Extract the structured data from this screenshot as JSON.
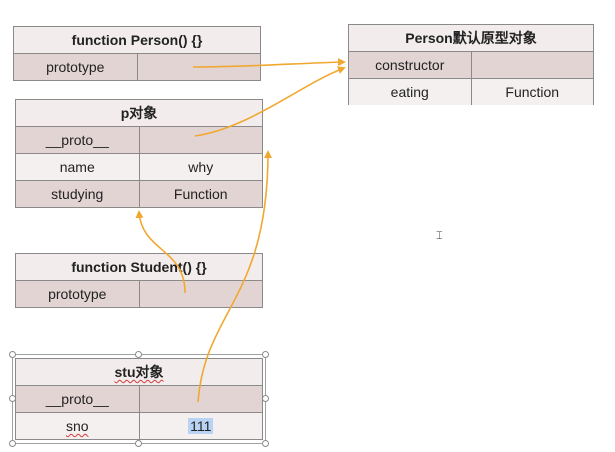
{
  "colors": {
    "arrow": "#f0a830",
    "header_bg": "#f2ecec",
    "shaded_row": "#e3d4d4",
    "light_row": "#f5f0f0",
    "border": "#8a8a8a",
    "selection_highlight": "#b9d3f4"
  },
  "person_function": {
    "title": "function Person() {}",
    "rows": [
      {
        "key": "prototype",
        "value": ""
      }
    ]
  },
  "person_prototype": {
    "title": "Person默认原型对象",
    "rows": [
      {
        "key": "constructor",
        "value": ""
      },
      {
        "key": "eating",
        "value": "Function"
      }
    ]
  },
  "p_object": {
    "title": "p对象",
    "rows": [
      {
        "key": "__proto__",
        "value": ""
      },
      {
        "key": "name",
        "value": "why"
      },
      {
        "key": "studying",
        "value": "Function"
      }
    ]
  },
  "student_function": {
    "title": "function Student() {}",
    "rows": [
      {
        "key": "prototype",
        "value": ""
      }
    ]
  },
  "stu_object": {
    "title": "stu对象",
    "rows": [
      {
        "key": "__proto__",
        "value": ""
      },
      {
        "key": "sno",
        "value": "111"
      }
    ]
  },
  "icons": {
    "cursor": "text-cursor-icon"
  }
}
